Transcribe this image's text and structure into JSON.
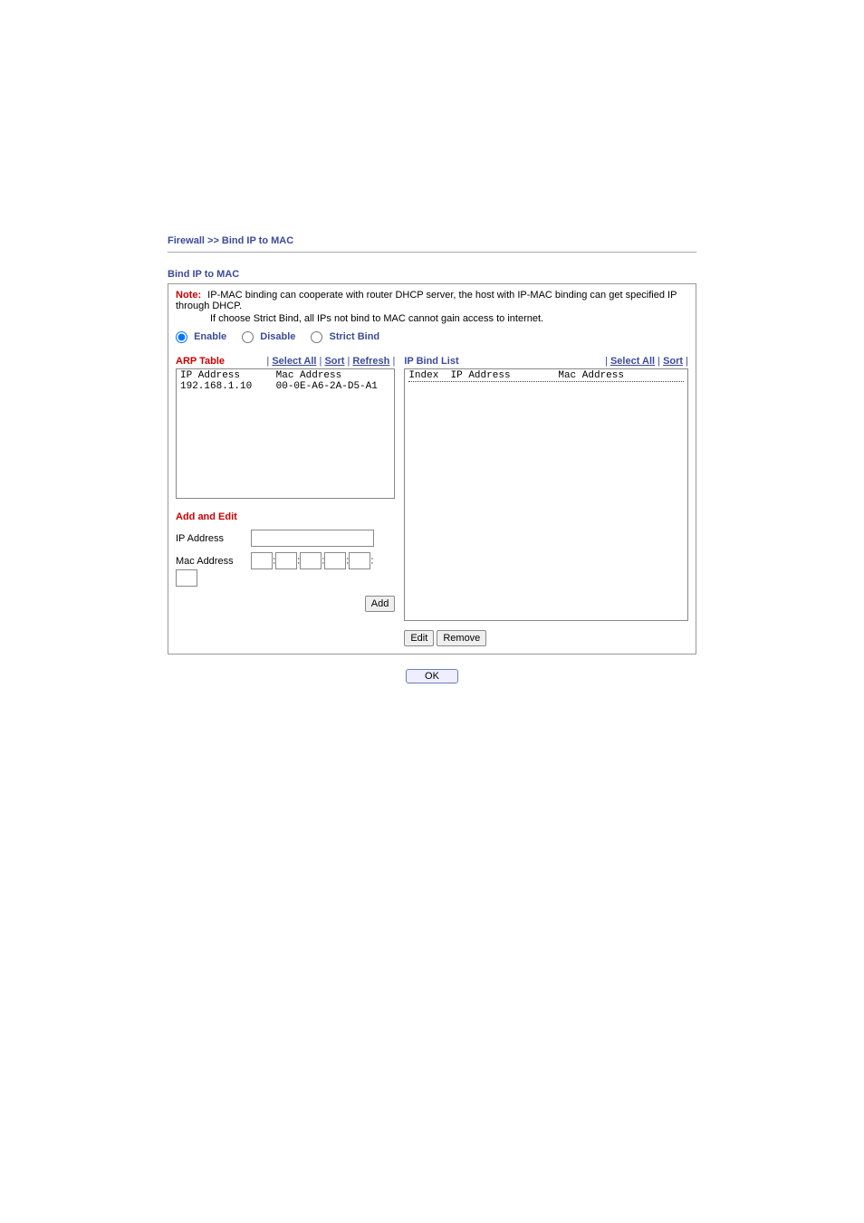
{
  "breadcrumb": "Firewall >> Bind IP to MAC",
  "section_title": "Bind IP to MAC",
  "note": {
    "label": "Note:",
    "line1": "IP-MAC binding can cooperate with router DHCP server, the host with IP-MAC binding can get specified IP through DHCP.",
    "line2": "If choose Strict Bind, all IPs not bind to MAC cannot gain access to internet."
  },
  "radios": {
    "enable": "Enable",
    "disable": "Disable",
    "strict": "Strict Bind",
    "selected": "enable"
  },
  "arp": {
    "title": "ARP Table",
    "links": {
      "select_all": "Select All",
      "sort": "Sort",
      "refresh": "Refresh"
    },
    "header": {
      "ip": "IP Address",
      "mac": "Mac Address"
    },
    "rows": [
      {
        "ip": "192.168.1.10",
        "mac": "00-0E-A6-2A-D5-A1"
      }
    ]
  },
  "bind": {
    "title": "IP Bind List",
    "links": {
      "select_all": "Select All",
      "sort": "Sort"
    },
    "header": {
      "index": "Index",
      "ip": "IP Address",
      "mac": "Mac Address"
    }
  },
  "add_edit": {
    "title": "Add and Edit",
    "ip_label": "IP Address",
    "mac_label": "Mac Address",
    "ip_value": "",
    "mac": [
      "",
      "",
      "",
      "",
      "",
      ""
    ]
  },
  "buttons": {
    "add": "Add",
    "edit": "Edit",
    "remove": "Remove",
    "ok": "OK"
  }
}
